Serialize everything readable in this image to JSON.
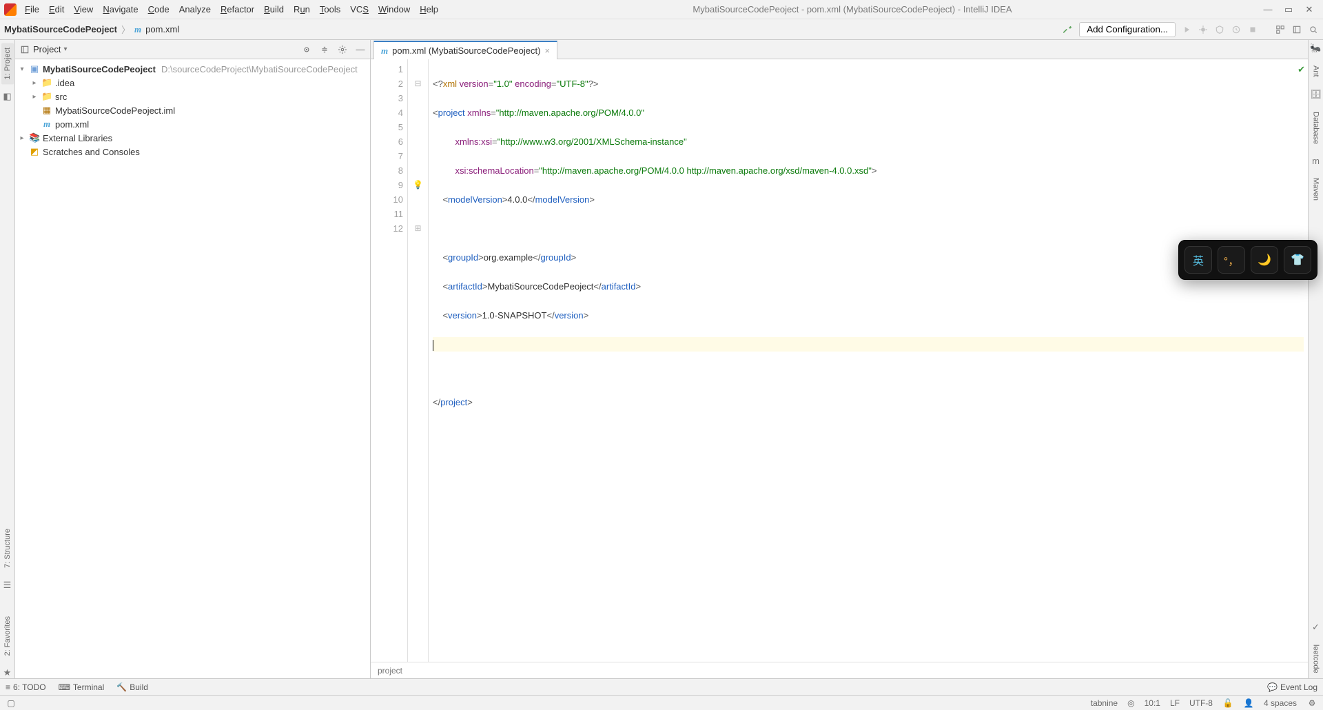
{
  "window": {
    "title": "MybatiSourceCodePeoject - pom.xml (MybatiSourceCodePeoject) - IntelliJ IDEA"
  },
  "menu": [
    "File",
    "Edit",
    "View",
    "Navigate",
    "Code",
    "Analyze",
    "Refactor",
    "Build",
    "Run",
    "Tools",
    "VCS",
    "Window",
    "Help"
  ],
  "breadcrumb": {
    "project": "MybatiSourceCodePeoject",
    "file": "pom.xml"
  },
  "run": {
    "addConfig": "Add Configuration..."
  },
  "leftRail": {
    "project": "1: Project",
    "structure": "7: Structure",
    "favorites": "2: Favorites"
  },
  "rightRail": {
    "ant": "Ant",
    "database": "Database",
    "maven": "Maven",
    "leetcode": "leetcode"
  },
  "projectPanel": {
    "title": "Project",
    "root": {
      "name": "MybatiSourceCodePeoject",
      "path": "D:\\sourceCodeProject\\MybatiSourceCodePeoject"
    },
    "children": [
      {
        "name": ".idea",
        "kind": "folder"
      },
      {
        "name": "src",
        "kind": "folder"
      },
      {
        "name": "MybatiSourceCodePeoject.iml",
        "kind": "iml"
      },
      {
        "name": "pom.xml",
        "kind": "m"
      }
    ],
    "extLibs": "External Libraries",
    "scratches": "Scratches and Consoles"
  },
  "editor": {
    "tabLabel": "pom.xml (MybatiSourceCodePeoject)",
    "breadcrumb": "project",
    "code": {
      "l1": {
        "pre": "<?",
        "pi": "xml",
        "sp": " ",
        "a1": "version",
        "eq1": "=",
        "v1": "\"1.0\"",
        "sp2": " ",
        "a2": "encoding",
        "eq2": "=",
        "v2": "\"UTF-8\"",
        "end": "?>"
      },
      "l2": {
        "open": "<",
        "tag": "project",
        "sp": " ",
        "a": "xmlns",
        "eq": "=",
        "v": "\"http://maven.apache.org/POM/4.0.0\""
      },
      "l3": {
        "pad": "         ",
        "a": "xmlns:xsi",
        "eq": "=",
        "v": "\"http://www.w3.org/2001/XMLSchema-instance\""
      },
      "l4": {
        "pad": "         ",
        "a": "xsi:schemaLocation",
        "eq": "=",
        "v": "\"http://maven.apache.org/POM/4.0.0 http://maven.apache.org/xsd/maven-4.0.0.xsd\"",
        "close": ">"
      },
      "l5": {
        "ind": "    ",
        "o": "<",
        "t": "modelVersion",
        "c1": ">",
        "val": "4.0.0",
        "c2": "</",
        "t2": "modelVersion",
        "c3": ">"
      },
      "l7": {
        "ind": "    ",
        "o": "<",
        "t": "groupId",
        "c1": ">",
        "val": "org.example",
        "c2": "</",
        "t2": "groupId",
        "c3": ">"
      },
      "l8": {
        "ind": "    ",
        "o": "<",
        "t": "artifactId",
        "c1": ">",
        "val": "MybatiSourceCodePeoject",
        "c2": "</",
        "t2": "artifactId",
        "c3": ">"
      },
      "l9": {
        "ind": "    ",
        "o": "<",
        "t": "version",
        "c1": ">",
        "val": "1.0-SNAPSHOT",
        "c2": "</",
        "t2": "version",
        "c3": ">"
      },
      "l12": {
        "o": "</",
        "t": "project",
        "c": ">"
      }
    },
    "lineNumbers": [
      "1",
      "2",
      "3",
      "4",
      "5",
      "6",
      "7",
      "8",
      "9",
      "10",
      "11",
      "12"
    ]
  },
  "toolWindows": {
    "todo": "6: TODO",
    "terminal": "Terminal",
    "build": "Build",
    "eventLog": "Event Log"
  },
  "status": {
    "tabnine": "tabnine",
    "pos": "10:1",
    "eol": "LF",
    "enc": "UTF-8",
    "indent": "4 spaces"
  },
  "ime": {
    "lang": "英",
    "punct": "°，",
    "moon": "🌙",
    "shirt": "👕"
  }
}
